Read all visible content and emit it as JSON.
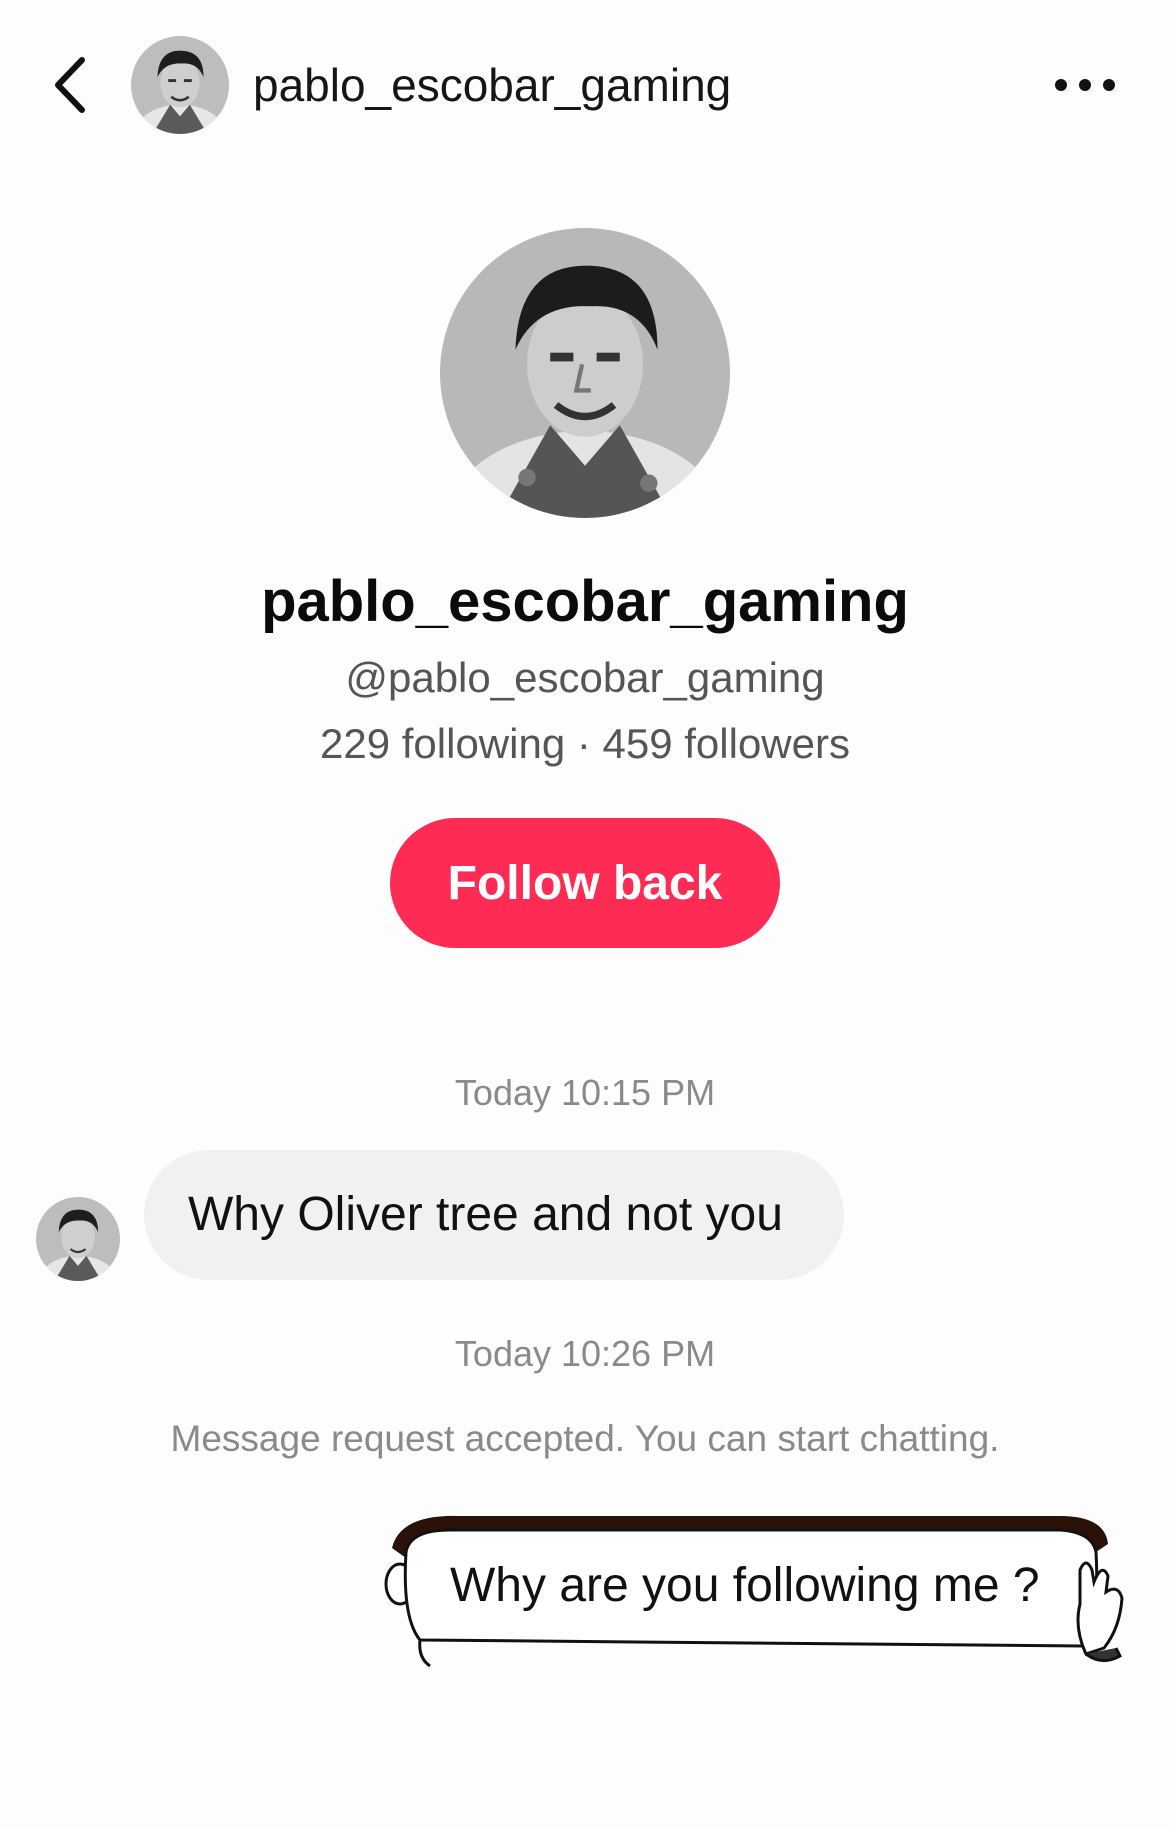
{
  "header": {
    "username": "pablo_escobar_gaming",
    "back_icon": "chevron-left-icon",
    "more_icon": "more-horizontal-icon"
  },
  "profile": {
    "name": "pablo_escobar_gaming",
    "handle": "@pablo_escobar_gaming",
    "stats": "229 following · 459 followers",
    "follow_label": "Follow back"
  },
  "conversation": {
    "timestamp_1": "Today 10:15 PM",
    "incoming_message": "Why Oliver tree and not you",
    "timestamp_2": "Today 10:26 PM",
    "system_note": "Message request accepted. You can start chatting.",
    "outgoing_sticker_text": "Why are you following me ?"
  },
  "colors": {
    "accent": "#fe2c55",
    "incoming_bubble": "#f1f1f2",
    "muted_text": "#8a8a8a",
    "sticker_hair": "#2a1208"
  }
}
